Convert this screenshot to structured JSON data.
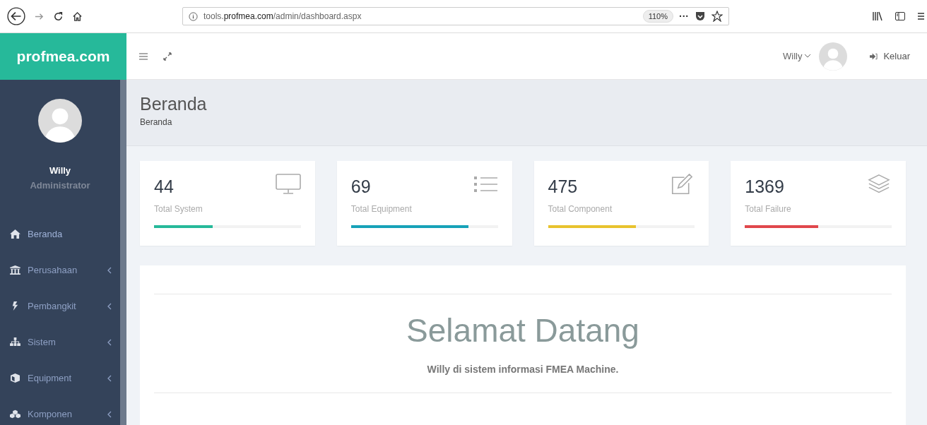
{
  "browser": {
    "url": "tools.**profmea.com**/admin/dashboard.aspx",
    "zoom": "110%",
    "more": "···"
  },
  "header": {
    "logo": "profmea.com",
    "user": "Willy",
    "logout": "Keluar"
  },
  "sidebar": {
    "user_name": "Willy",
    "role": "Administrator",
    "items": [
      {
        "label": "Beranda",
        "submenu": false,
        "selected": true
      },
      {
        "label": "Perusahaan",
        "submenu": true,
        "selected": false
      },
      {
        "label": "Pembangkit",
        "submenu": true,
        "selected": false
      },
      {
        "label": "Sistem",
        "submenu": true,
        "selected": false
      },
      {
        "label": "Equipment",
        "submenu": true,
        "selected": false
      },
      {
        "label": "Komponen",
        "submenu": true,
        "selected": false
      }
    ]
  },
  "page": {
    "title": "Beranda",
    "breadcrumb": "Beranda"
  },
  "stats": [
    {
      "value": "44",
      "label": "Total System",
      "color": "#26b99a",
      "level": 0.4
    },
    {
      "value": "69",
      "label": "Total Equipment",
      "color": "#17a2b8",
      "level": 0.8
    },
    {
      "value": "475",
      "label": "Total Component",
      "color": "#e8c32e",
      "level": 0.6
    },
    {
      "value": "1369",
      "label": "Total Failure",
      "color": "#e0474c",
      "level": 0.5
    }
  ],
  "welcome": {
    "title": "Selamat Datang",
    "text": "Willy di sistem informasi FMEA Machine."
  }
}
